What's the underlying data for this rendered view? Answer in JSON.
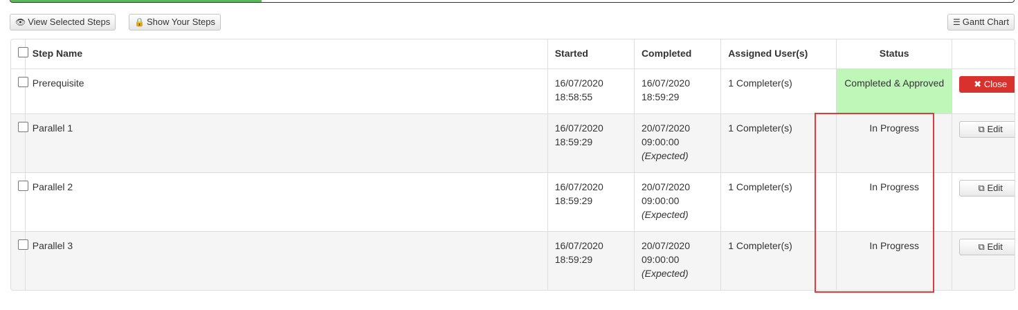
{
  "progress": {
    "fraction": 0.25,
    "color": "#5cb85c"
  },
  "toolbar": {
    "view_selected": {
      "icon": "eye-icon",
      "label": "View Selected Steps"
    },
    "show_yours": {
      "icon": "lock-icon",
      "label": "Show Your Steps"
    },
    "gantt": {
      "icon": "gantt-icon",
      "label": "Gantt Chart"
    }
  },
  "table": {
    "headers": {
      "step": "Step Name",
      "started": "Started",
      "completed": "Completed",
      "users": "Assigned User(s)",
      "status": "Status"
    },
    "rows": [
      {
        "step": "Prerequisite",
        "started_date": "16/07/2020",
        "started_time": "18:58:55",
        "completed_date": "16/07/2020",
        "completed_time": "18:59:29",
        "completed_note": "",
        "users": "1 Completer(s)",
        "status": "Completed & Approved",
        "status_color": "#bff7b9",
        "action": "Close",
        "action_icon": "close-icon"
      },
      {
        "step": "Parallel 1",
        "started_date": "16/07/2020",
        "started_time": "18:59:29",
        "completed_date": "20/07/2020",
        "completed_time": "09:00:00",
        "completed_note": "(Expected)",
        "users": "1 Completer(s)",
        "status": "In Progress",
        "action": "Edit",
        "action_icon": "external-link-icon"
      },
      {
        "step": "Parallel 2",
        "started_date": "16/07/2020",
        "started_time": "18:59:29",
        "completed_date": "20/07/2020",
        "completed_time": "09:00:00",
        "completed_note": "(Expected)",
        "users": "1 Completer(s)",
        "status": "In Progress",
        "action": "Edit",
        "action_icon": "external-link-icon"
      },
      {
        "step": "Parallel 3",
        "started_date": "16/07/2020",
        "started_time": "18:59:29",
        "completed_date": "20/07/2020",
        "completed_time": "09:00:00",
        "completed_note": "(Expected)",
        "users": "1 Completer(s)",
        "status": "In Progress",
        "action": "Edit",
        "action_icon": "external-link-icon"
      }
    ]
  },
  "highlight_color": "#e03a3a"
}
